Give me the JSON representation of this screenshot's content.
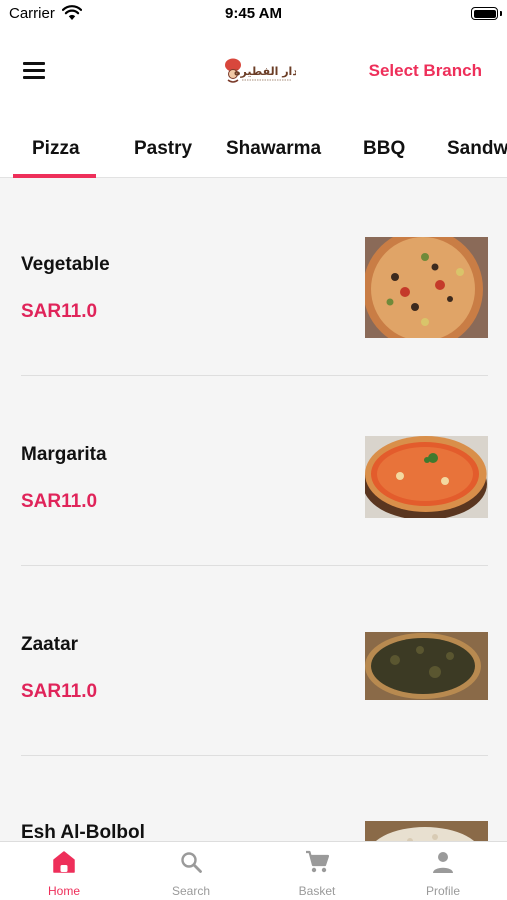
{
  "status_bar": {
    "carrier": "Carrier",
    "time": "9:45 AM"
  },
  "header": {
    "logo_text": "دار الفطيرة",
    "select_branch_label": "Select Branch"
  },
  "categories": {
    "selected": "Pizza",
    "tabs": [
      {
        "label": "Pizza"
      },
      {
        "label": "Pastry"
      },
      {
        "label": "Shawarma"
      },
      {
        "label": "BBQ"
      },
      {
        "label": "Sandw"
      }
    ]
  },
  "products": [
    {
      "name": "Vegetable",
      "price": "SAR11.0"
    },
    {
      "name": "Margarita",
      "price": "SAR11.0"
    },
    {
      "name": "Zaatar",
      "price": "SAR11.0"
    },
    {
      "name": "Esh Al-Bolbol",
      "price": ""
    }
  ],
  "bottom_nav": {
    "selected": "Home",
    "items": [
      {
        "label": "Home",
        "icon": "home-icon"
      },
      {
        "label": "Search",
        "icon": "search-icon"
      },
      {
        "label": "Basket",
        "icon": "cart-icon"
      },
      {
        "label": "Profile",
        "icon": "person-icon"
      }
    ]
  },
  "colors": {
    "accent": "#ee2f5a",
    "price": "#e0245a",
    "inactive": "#9a9a9a"
  }
}
